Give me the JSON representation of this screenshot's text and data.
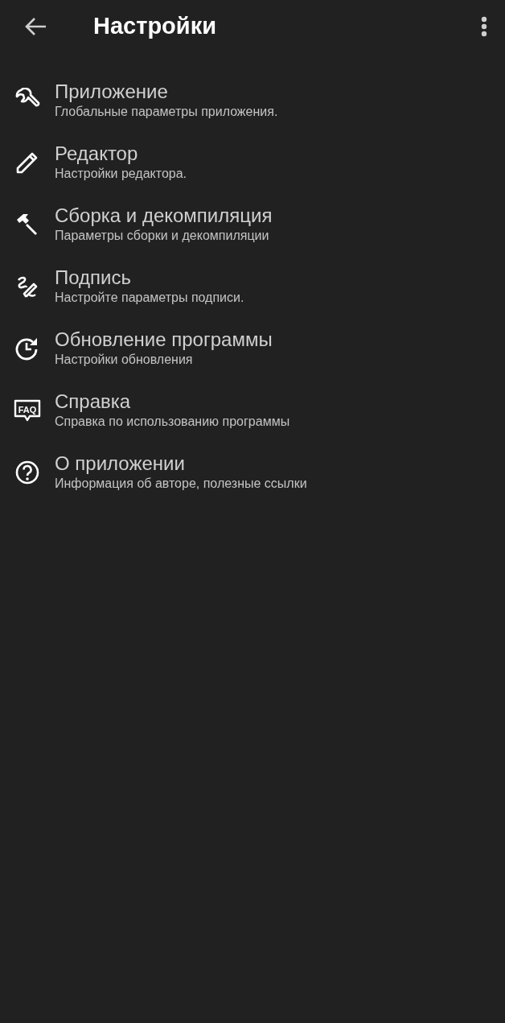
{
  "app_bar": {
    "title": "Настройки"
  },
  "items": [
    {
      "title": "Приложение",
      "subtitle": "Глобальные параметры приложения."
    },
    {
      "title": "Редактор",
      "subtitle": "Настройки редактора."
    },
    {
      "title": "Сборка и декомпиляция",
      "subtitle": "Параметры сборки и декомпиляции"
    },
    {
      "title": "Подпись",
      "subtitle": "Настройте параметры подписи."
    },
    {
      "title": "Обновление программы",
      "subtitle": "Настройки обновления"
    },
    {
      "icon_text": "FAQ",
      "title": "Справка",
      "subtitle": "Справка по использованию программы"
    },
    {
      "title": "О приложении",
      "subtitle": "Информация об авторе, полезные ссылки"
    }
  ]
}
